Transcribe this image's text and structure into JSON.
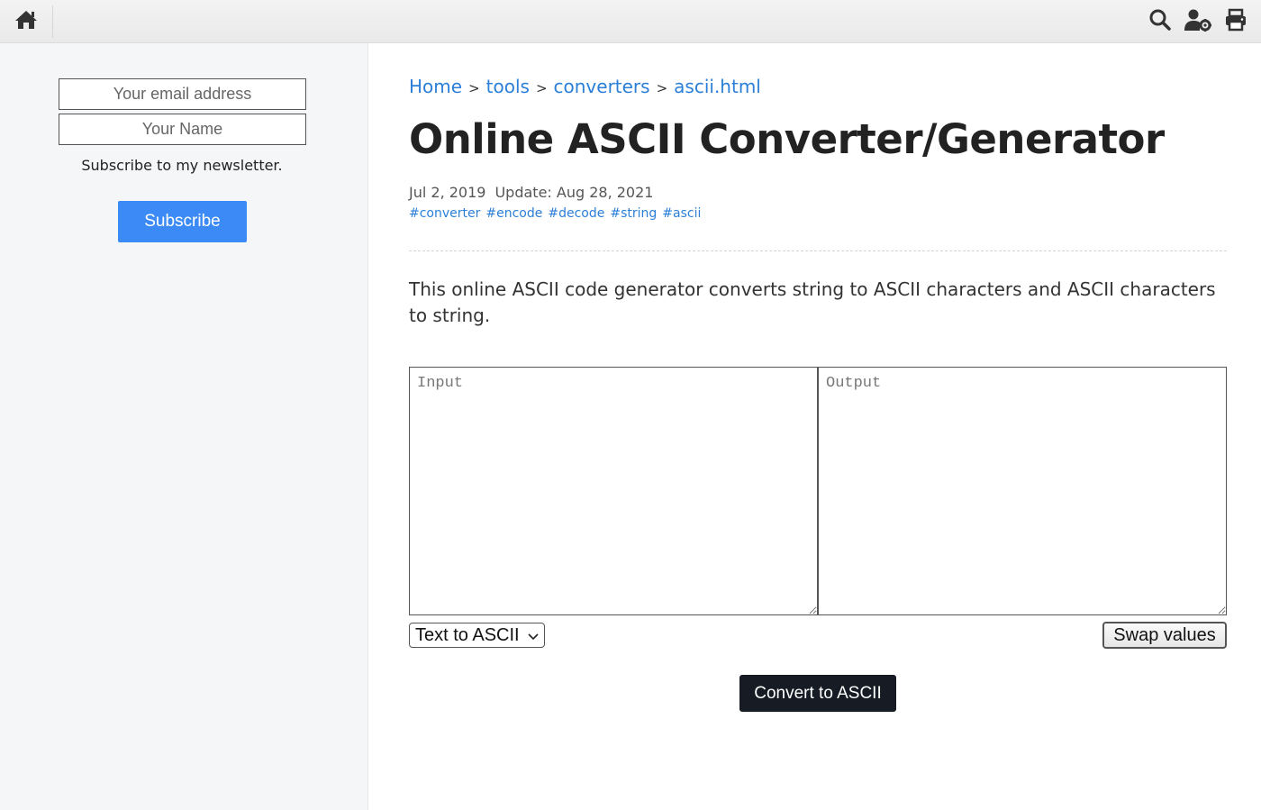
{
  "topbar": {
    "home_icon": "home-icon",
    "search_icon": "search-icon",
    "user_settings_icon": "user-gear-icon",
    "print_icon": "print-icon"
  },
  "sidebar": {
    "email_placeholder": "Your email address",
    "name_placeholder": "Your Name",
    "subscribe_text": "Subscribe to my newsletter.",
    "subscribe_button": "Subscribe",
    "subscribe_color": "#3b8af5"
  },
  "breadcrumb": {
    "items": [
      "Home",
      "tools",
      "converters",
      "ascii.html"
    ],
    "separator": ">"
  },
  "page": {
    "title": "Online ASCII Converter/Generator",
    "date": "Jul 2, 2019",
    "updated": "Update: Aug 28, 2021",
    "tags": [
      "#converter",
      "#encode",
      "#decode",
      "#string",
      "#ascii"
    ],
    "intro": "This online ASCII code generator converts string to ASCII characters and ASCII characters to string."
  },
  "tool": {
    "input_placeholder": "Input",
    "output_placeholder": "Output",
    "mode_selected": "Text to ASCII",
    "swap_button": "Swap values",
    "convert_button": "Convert to ASCII"
  },
  "colors": {
    "link": "#2b7fd8",
    "convert_bg": "#161b24"
  }
}
